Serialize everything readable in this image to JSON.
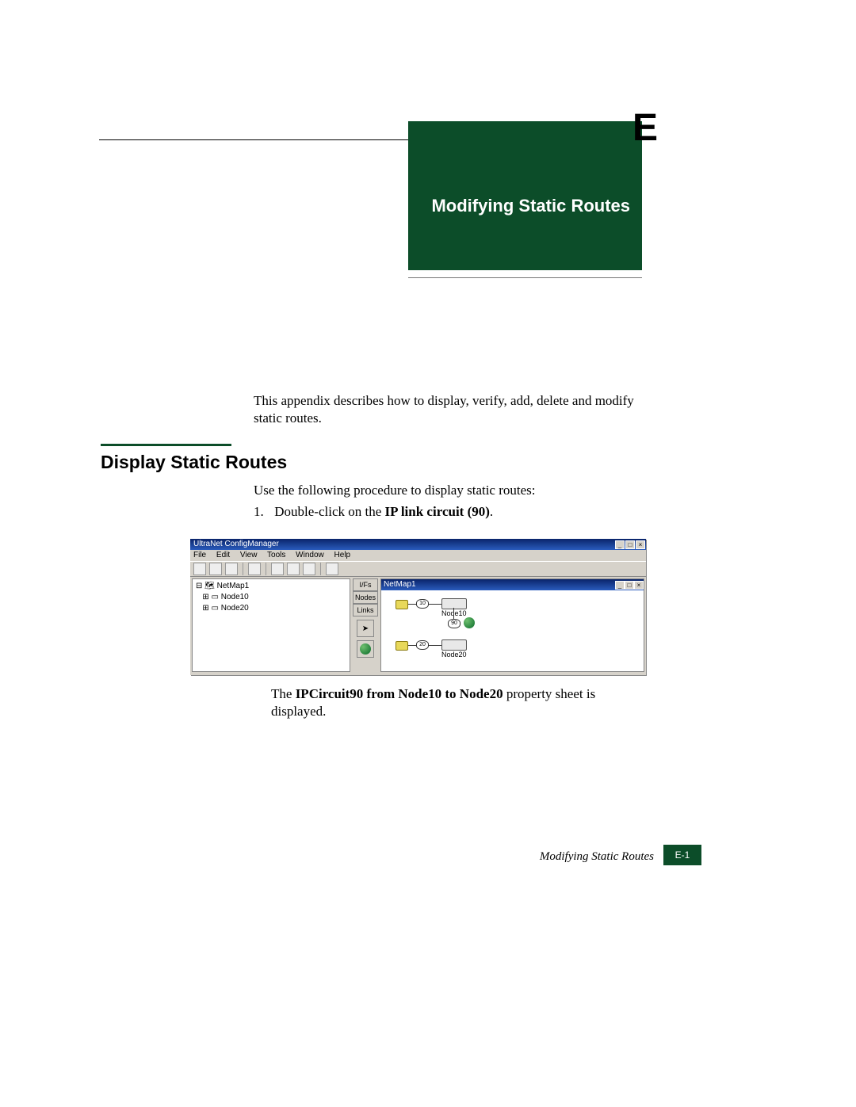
{
  "appendix_letter": "E",
  "chapter_title": "Modifying Static Routes",
  "intro": "This appendix describes how to display, verify, add, delete and modify static routes.",
  "section_heading": "Display Static Routes",
  "para_use": "Use the following procedure to display static routes:",
  "step1_num": "1.",
  "step1_pre": "Double-click on the ",
  "step1_bold": "IP link circuit (90)",
  "step1_post": ".",
  "after_pre": "The ",
  "after_bold": "IPCircuit90 from Node10 to Node20",
  "after_post": " property sheet is displayed.",
  "footer_title": "Modifying Static Routes",
  "footer_page": "E-1",
  "screenshot": {
    "outer_title": "UltraNet ConfigManager",
    "menu": {
      "file": "File",
      "edit": "Edit",
      "view": "View",
      "tools": "Tools",
      "window": "Window",
      "help": "Help"
    },
    "tree_root": "NetMap1",
    "tree_node1": "Node10",
    "tree_node2": "Node20",
    "side": {
      "ifs": "I/Fs",
      "nodes": "Nodes",
      "links": "Links"
    },
    "inner_title": "NetMap1",
    "node1_label": "Node10",
    "node2_label": "Node20",
    "c_top": "10",
    "c_mid": "90",
    "c_bot": "20"
  }
}
